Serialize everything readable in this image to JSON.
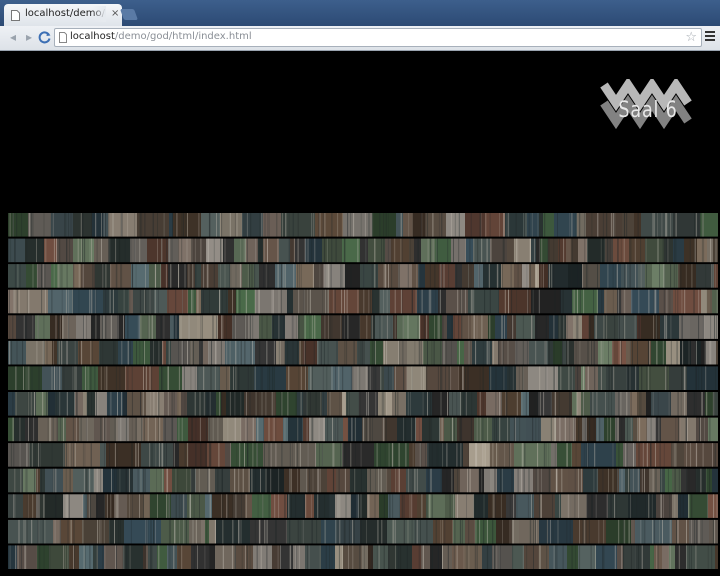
{
  "browser": {
    "tab": {
      "title": "localhost/demo/god/ht",
      "close_glyph": "×",
      "favicon": "page-icon"
    },
    "toolbar": {
      "back_glyph": "◂",
      "forward_glyph": "▸",
      "reload_icon": "reload-icon",
      "url_host": "localhost",
      "url_path": "/demo/god/html/index.html",
      "star_glyph": "☆",
      "menu_icon": "menu-icon"
    }
  },
  "page": {
    "logo": "wave-logo-icon",
    "room_label": "Saal 6",
    "mosaic": {
      "description_icon": "video-thumbnail-mosaic",
      "rows": 14,
      "colors": [
        "#6b5a4d",
        "#4e5a54",
        "#7c6c5c",
        "#3d4a47",
        "#8a7f73",
        "#5a6e74",
        "#2f3c3e",
        "#7a5546",
        "#969089",
        "#4b6b4a",
        "#5d4a3a",
        "#a79d8d",
        "#39505c",
        "#6d8067",
        "#3a3a3a",
        "#82746a",
        "#586563"
      ]
    }
  }
}
